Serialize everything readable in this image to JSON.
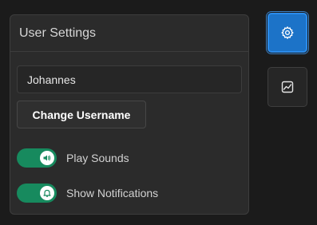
{
  "panel": {
    "title": "User Settings",
    "username_value": "Johannes",
    "change_username_label": "Change Username"
  },
  "toggles": [
    {
      "label": "Play Sounds",
      "on": true,
      "icon": "speaker-icon"
    },
    {
      "label": "Show Notifications",
      "on": true,
      "icon": "bell-icon"
    }
  ],
  "side_buttons": [
    {
      "name": "settings",
      "icon": "gear-icon",
      "active": true
    },
    {
      "name": "stats",
      "icon": "chart-icon",
      "active": false
    }
  ],
  "colors": {
    "accent": "#1c73c8",
    "toggle_on": "#178a5e",
    "background": "#1b1b1b",
    "panel": "#2b2b2b"
  }
}
